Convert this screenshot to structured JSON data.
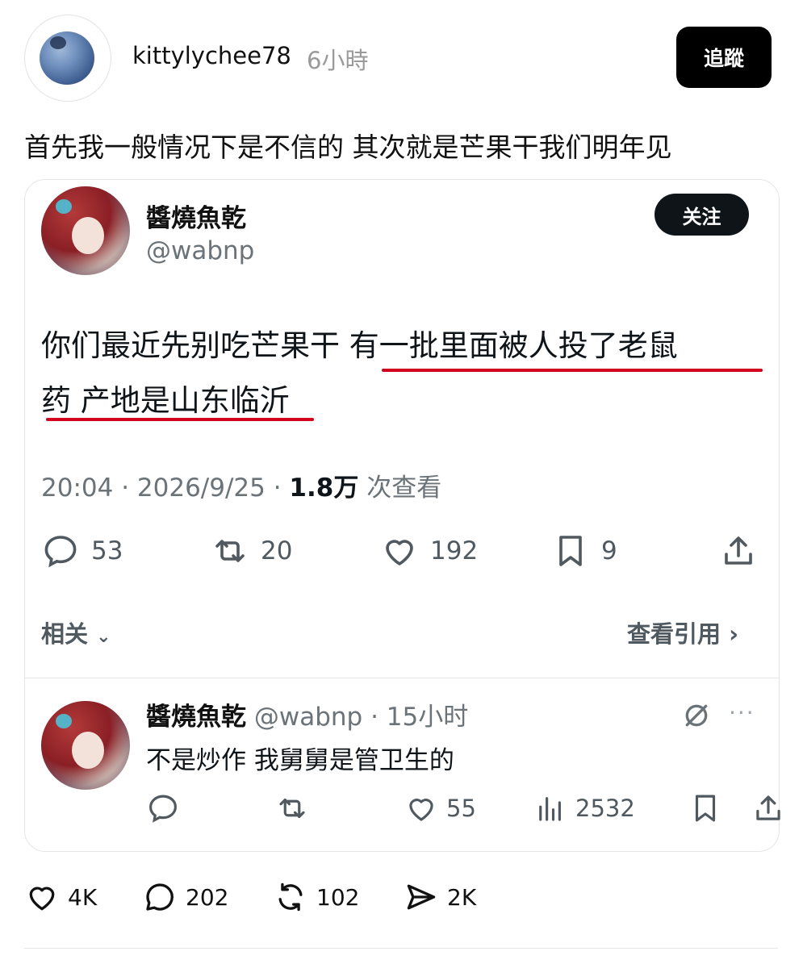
{
  "post": {
    "username": "kittylychee78",
    "time": "6小時",
    "follow_label": "追蹤",
    "caption": "首先我一般情况下是不信的 其次就是芒果干我们明年见"
  },
  "tweet": {
    "display_name": "醬燒魚乾",
    "handle": "@wabnp",
    "follow_label": "关注",
    "text_line1_plain": "你们最近先别吃芒果干 ",
    "text_line1_underlined": "有一批里面被人投了老鼠",
    "text_line2_underlined": "药 产地是山东临沂",
    "timestamp": "20:04 · 2026/9/25 · ",
    "views_count": "1.8万",
    "views_label": " 次查看",
    "reply_count": "53",
    "retweet_count": "20",
    "like_count": "192",
    "bookmark_count": "9",
    "related_label": "相关",
    "view_quotes_label": "查看引用",
    "underline_color": "#d2001e"
  },
  "reply": {
    "display_name": "醬燒魚乾",
    "handle_time": "@wabnp · 15小时",
    "text": "不是炒作 我舅舅是管卫生的",
    "like_count": "55",
    "views_count": "2532",
    "more": "···"
  },
  "footer": {
    "likes": "4K",
    "comments": "202",
    "reposts": "102",
    "shares": "2K"
  }
}
